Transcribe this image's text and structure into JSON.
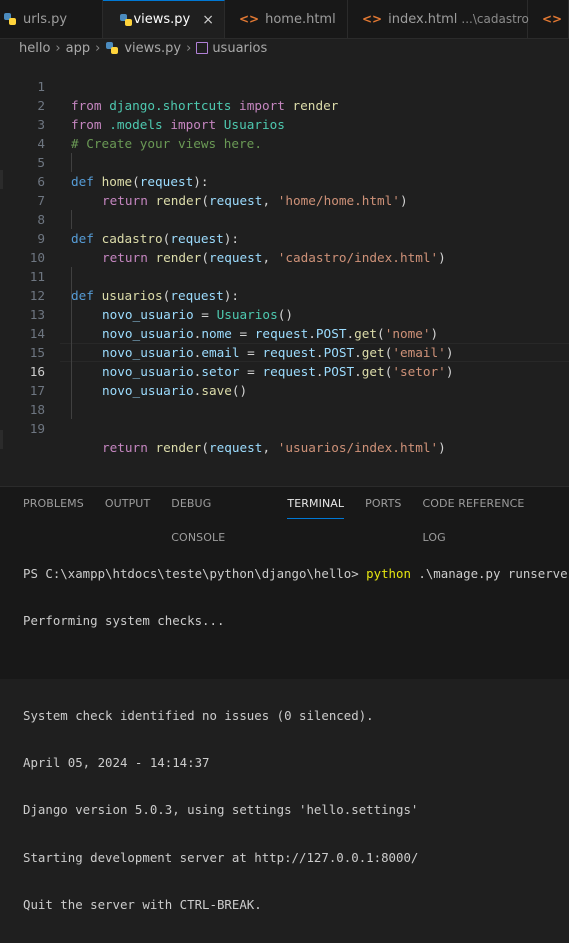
{
  "tabs": [
    {
      "name": "urls.py",
      "type": "py",
      "active": false
    },
    {
      "name": "views.py",
      "type": "py",
      "active": true,
      "close": "×"
    },
    {
      "name": "home.html",
      "type": "html",
      "active": false
    },
    {
      "name": "index.html",
      "hint": "...\\cadastro",
      "type": "html",
      "active": false
    }
  ],
  "breadcrumb": [
    "hello",
    "app",
    "views.py",
    "usuarios"
  ],
  "code": {
    "l1": {
      "a": "from ",
      "b": "django.shortcuts",
      "c": " import ",
      "d": "render"
    },
    "l2": {
      "a": "from ",
      "b": ".models",
      "c": " import ",
      "d": "Usuarios"
    },
    "l3": "# Create your views here.",
    "l5": {
      "a": "def ",
      "b": "home",
      "c": "(",
      "d": "request",
      "e": "):"
    },
    "l6": {
      "a": "return ",
      "b": "render",
      "c": "(",
      "d": "request",
      "e": ", ",
      "f": "'home/home.html'",
      "g": ")"
    },
    "l8": {
      "a": "def ",
      "b": "cadastro",
      "c": "(",
      "d": "request",
      "e": "):"
    },
    "l9": {
      "a": "return ",
      "b": "render",
      "c": "(",
      "d": "request",
      "e": ", ",
      "f": "'cadastro/index.html'",
      "g": ")"
    },
    "l11": {
      "a": "def ",
      "b": "usuarios",
      "c": "(",
      "d": "request",
      "e": "):"
    },
    "l12": {
      "a": "novo_usuario",
      "b": " = ",
      "c": "Usuarios",
      "d": "()"
    },
    "l13": {
      "a": "novo_usuario",
      "b": ".",
      "c": "nome",
      "d": " = ",
      "e": "request",
      "f": ".",
      "g": "POST",
      "h": ".",
      "i": "get",
      "j": "(",
      "k": "'nome'",
      "l": ")"
    },
    "l14": {
      "a": "novo_usuario",
      "b": ".",
      "c": "email",
      "d": " = ",
      "e": "request",
      "f": ".",
      "g": "POST",
      "h": ".",
      "i": "get",
      "j": "(",
      "k": "'email'",
      "l": ")"
    },
    "l15": {
      "a": "novo_usuario",
      "b": ".",
      "c": "setor",
      "d": " = ",
      "e": "request",
      "f": ".",
      "g": "POST",
      "h": ".",
      "i": "get",
      "j": "(",
      "k": "'setor'",
      "l": ")"
    },
    "l16": {
      "a": "novo_usuario",
      "b": ".",
      "c": "save",
      "d": "()"
    },
    "l19": {
      "a": "return ",
      "b": "render",
      "c": "(",
      "d": "request",
      "e": ", ",
      "f": "'usuarios/index.html'",
      "g": ")"
    }
  },
  "line_numbers": [
    "1",
    "2",
    "3",
    "4",
    "5",
    "6",
    "7",
    "8",
    "9",
    "10",
    "11",
    "12",
    "13",
    "14",
    "15",
    "16",
    "17",
    "18",
    "19"
  ],
  "panel_tabs": [
    "PROBLEMS",
    "OUTPUT",
    "DEBUG CONSOLE",
    "TERMINAL",
    "PORTS",
    "CODE REFERENCE LOG"
  ],
  "terminal": {
    "prompt": "PS C:\\xampp\\htdocs\\teste\\python\\django\\hello> ",
    "cmd": "python",
    "args": " .\\manage.py runserver",
    "lines": [
      "Performing system checks...",
      "",
      "System check identified no issues (0 silenced).",
      "April 05, 2024 - 14:14:37",
      "Django version 5.0.3, using settings 'hello.settings'",
      "Starting development server at http://127.0.0.1:8000/",
      "Quit the server with CTRL-BREAK."
    ]
  },
  "colors": {
    "accent": "#0078d4",
    "keyword": "#569cd6",
    "control": "#c586c0",
    "function": "#dcdcaa",
    "variable": "#9cdcfe",
    "class": "#4ec9b0",
    "string": "#ce9178",
    "comment": "#6a9955"
  }
}
